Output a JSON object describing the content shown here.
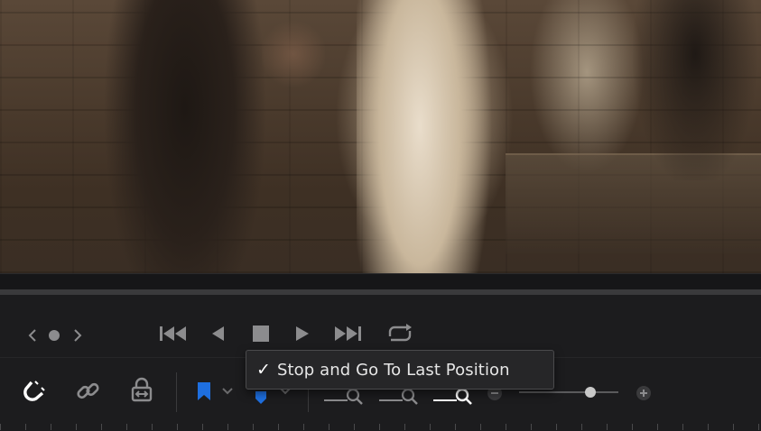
{
  "viewer": {
    "frame": "video-frame"
  },
  "transport": {
    "buttons": [
      {
        "name": "jog-prev-icon"
      },
      {
        "name": "jog-dot-icon"
      },
      {
        "name": "jog-next-icon"
      },
      {
        "name": "go-to-start-icon"
      },
      {
        "name": "play-reverse-icon"
      },
      {
        "name": "stop-icon"
      },
      {
        "name": "play-icon"
      },
      {
        "name": "go-to-end-icon"
      },
      {
        "name": "loop-icon"
      }
    ]
  },
  "menu": {
    "items": [
      {
        "label": "Stop and Go To Last Position",
        "checked": true,
        "check_glyph": "✓"
      }
    ]
  },
  "toolbar": {
    "tools": [
      "snapping-magnet-icon",
      "linked-selection-icon",
      "position-lock-icon",
      "flag-icon",
      "marker-icon",
      "full-extent-zoom-icon",
      "detail-zoom-icon",
      "custom-zoom-icon",
      "zoom-out-icon",
      "zoom-in-icon"
    ],
    "zoom_level": 0.72,
    "colors": {
      "accent": "#1e6fe0",
      "icon": "#c8c8c8",
      "dim_icon": "#8c8c8e"
    }
  }
}
